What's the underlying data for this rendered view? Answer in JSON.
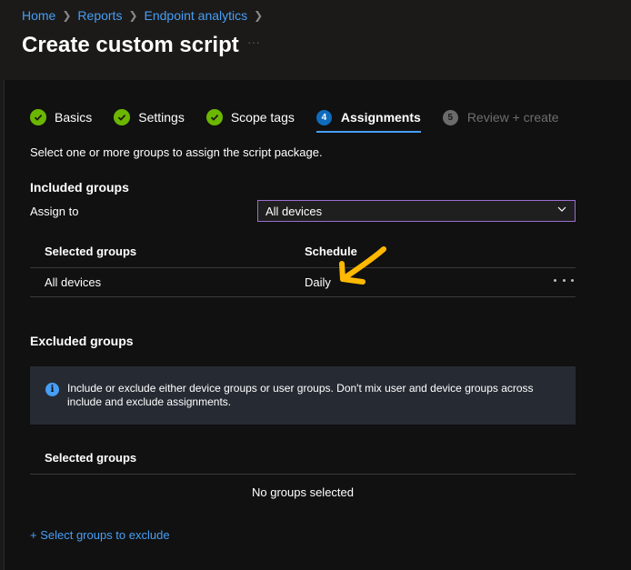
{
  "breadcrumb": {
    "items": [
      "Home",
      "Reports",
      "Endpoint analytics"
    ]
  },
  "page": {
    "title": "Create custom script",
    "title_more": "···"
  },
  "wizard": {
    "steps": [
      {
        "label": "Basics",
        "state": "complete"
      },
      {
        "label": "Settings",
        "state": "complete"
      },
      {
        "label": "Scope tags",
        "state": "complete"
      },
      {
        "label": "Assignments",
        "number": "4",
        "state": "active"
      },
      {
        "label": "Review + create",
        "number": "5",
        "state": "disabled"
      }
    ]
  },
  "main": {
    "description": "Select one or more groups to assign the script package.",
    "included": {
      "heading": "Included groups",
      "assign_to_label": "Assign to",
      "assign_to_value": "All devices",
      "columns": [
        "Selected groups",
        "Schedule"
      ],
      "rows": [
        {
          "group": "All devices",
          "schedule": "Daily"
        }
      ]
    },
    "excluded": {
      "heading": "Excluded groups",
      "info_text": "Include or exclude either device groups or user groups. Don't mix user and device groups across include and exclude assignments.",
      "column": "Selected groups",
      "empty_text": "No groups selected",
      "add_link": "+ Select groups to exclude"
    }
  },
  "colors": {
    "accent": "#479ef5",
    "success": "#6bb700",
    "annotation_arrow": "#ffb900",
    "dropdown_border": "#9b6ed0"
  }
}
